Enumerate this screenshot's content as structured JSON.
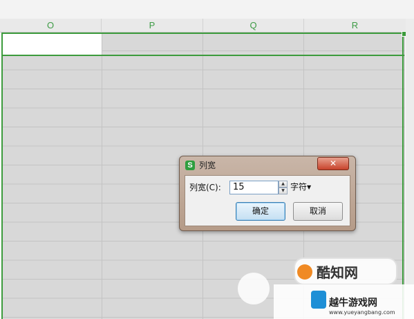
{
  "columns": [
    "O",
    "P",
    "Q",
    "R"
  ],
  "dialog": {
    "title": "列宽",
    "close_symbol": "✕",
    "field_label": "列宽(C):",
    "value": "15",
    "unit": "字符",
    "ok_label": "确定",
    "cancel_label": "取消"
  },
  "watermarks": {
    "badge_text": "酷知网",
    "bottom_text": "越牛游戏网",
    "bottom_url": "www.yueyangbang.com"
  },
  "colors": {
    "accent": "#3c9b3c",
    "column_text": "#3d9b45",
    "grid_fill": "#d8d8d8"
  }
}
